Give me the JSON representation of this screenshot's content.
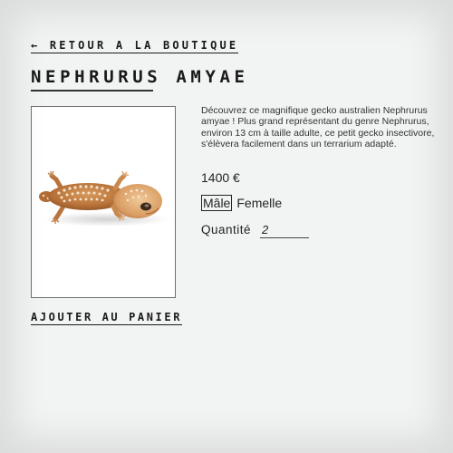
{
  "nav": {
    "back_label": "← RETOUR A LA BOUTIQUE"
  },
  "product": {
    "title": "NEPHRURUS AMYAE",
    "image_subject": "gecko-photo",
    "description": "Découvrez ce magnifique gecko australien Nephrurus amyae ! Plus grand représentant du genre Nephrurus, environ 13 cm à taille adulte, ce petit gecko insectivore, s'élèvera facilement dans un terrarium adapté.",
    "price": "1400 €",
    "variants": [
      {
        "label": "Mâle",
        "selected": true
      },
      {
        "label": "Femelle",
        "selected": false
      }
    ],
    "quantity_label": "Quantité",
    "quantity_value": "2",
    "add_to_cart_label": "AJOUTER AU PANIER"
  },
  "colors": {
    "background": "#f2f4f3",
    "text": "#1a1a1a",
    "frame_border": "#6e6e6e",
    "gecko_body": "#c98a4e",
    "gecko_spots": "#f3e5cf"
  }
}
